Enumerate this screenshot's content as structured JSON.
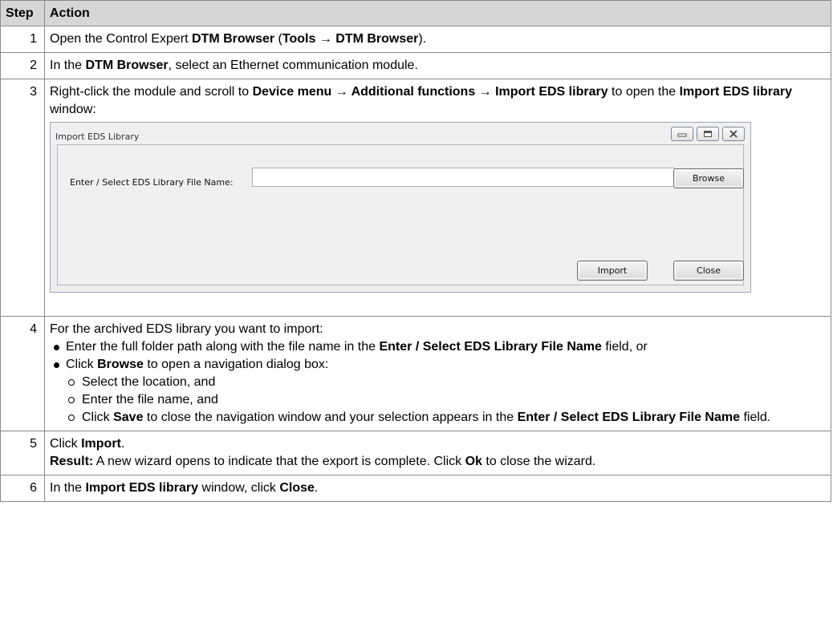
{
  "table": {
    "headers": {
      "step": "Step",
      "action": "Action"
    }
  },
  "steps": {
    "s1": {
      "num": "1",
      "t1": "Open the Control Expert ",
      "b1": "DTM Browser",
      "t2": " (",
      "b2": "Tools → DTM Browser",
      "t3": ")."
    },
    "s2": {
      "num": "2",
      "t1": "In the ",
      "b1": "DTM Browser",
      "t2": ", select an Ethernet communication module."
    },
    "s3": {
      "num": "3",
      "t1": "Right-click the module and scroll to ",
      "b1": "Device menu → Additional functions → Import EDS library",
      "t2": " to open the ",
      "b2": "Import EDS library",
      "t3": " window:"
    },
    "s4": {
      "num": "4",
      "intro": "For the archived EDS library you want to import:",
      "bullet1": {
        "t1": "Enter the full folder path along with the file name in the ",
        "b1": "Enter / Select EDS Library File Name",
        "t2": " field, or"
      },
      "bullet2": {
        "t1": "Click ",
        "b1": "Browse",
        "t2": " to open a navigation dialog box:"
      },
      "sub1": "Select the location, and",
      "sub2": "Enter the file name, and",
      "sub3": {
        "t1": "Click ",
        "b1": "Save",
        "t2": " to close the navigation window and your selection appears in the ",
        "b2": "Enter / Select EDS Library File Name",
        "t3": " field."
      }
    },
    "s5": {
      "num": "5",
      "t1": "Click ",
      "b1": "Import",
      "t2": ".",
      "r_label": "Result:",
      "r_t1": " A new wizard opens to indicate that the export is complete. Click ",
      "r_b1": "Ok",
      "r_t2": " to close the wizard."
    },
    "s6": {
      "num": "6",
      "t1": "In the ",
      "b1": "Import EDS library",
      "t2": " window, click ",
      "b2": "Close",
      "t3": "."
    }
  },
  "dialog": {
    "title": "Import EDS Library",
    "field_label": "Enter / Select EDS Library File Name:",
    "field_value": "",
    "browse_label": "Browse",
    "import_label": "Import",
    "close_label": "Close"
  }
}
